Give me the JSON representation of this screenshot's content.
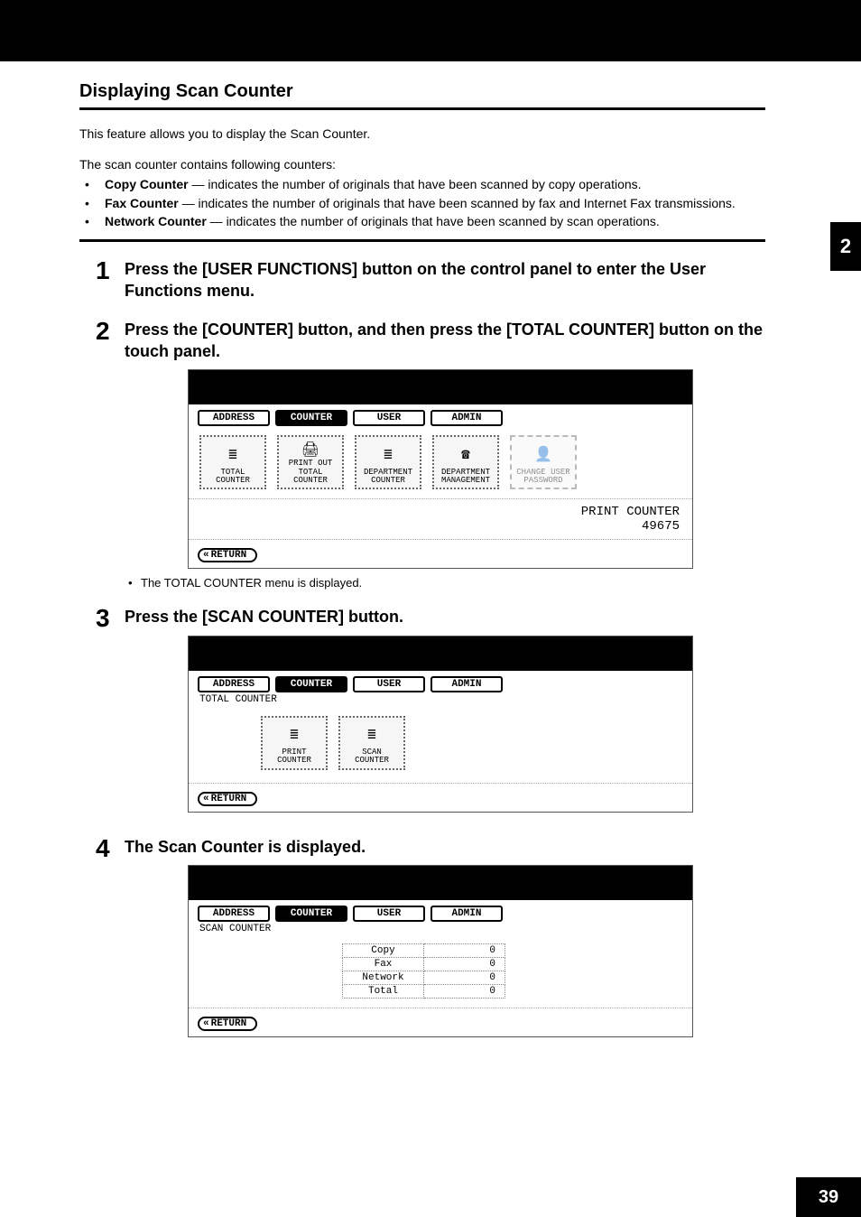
{
  "page_number": "39",
  "chapter_number": "2",
  "section_title": "Displaying Scan Counter",
  "intro_text": "This feature allows you to display the Scan Counter.",
  "counters_intro": "The scan counter contains following counters:",
  "counters": [
    {
      "name": "Copy Counter",
      "desc": " — indicates the number of originals that have been scanned by copy operations."
    },
    {
      "name": "Fax Counter",
      "desc": " — indicates the number of originals that have been scanned by fax and Internet Fax transmissions."
    },
    {
      "name": "Network Counter",
      "desc": " — indicates the number of originals that have been scanned by scan operations."
    }
  ],
  "steps": {
    "s1": {
      "num": "1",
      "text": "Press the [USER FUNCTIONS] button on the control panel to enter the User Functions menu."
    },
    "s2": {
      "num": "2",
      "text": "Press the [COUNTER] button, and then press the [TOTAL COUNTER] button on the touch panel.",
      "note": "The TOTAL COUNTER menu is displayed."
    },
    "s3": {
      "num": "3",
      "text": "Press the [SCAN COUNTER] button."
    },
    "s4": {
      "num": "4",
      "text": "The Scan Counter is displayed."
    }
  },
  "panel_tabs": {
    "address": "ADDRESS",
    "counter": "COUNTER",
    "user": "USER",
    "admin": "ADMIN"
  },
  "panel1": {
    "icons": {
      "total_counter": "TOTAL\nCOUNTER",
      "print_out": "PRINT OUT\nTOTAL COUNTER",
      "dept_counter": "DEPARTMENT\nCOUNTER",
      "dept_mgmt": "DEPARTMENT\nMANAGEMENT",
      "change_pw": "CHANGE USER\nPASSWORD"
    },
    "readout_label": "PRINT COUNTER",
    "readout_value": "49675",
    "return": "RETURN"
  },
  "panel2": {
    "sublabel": "TOTAL COUNTER",
    "icons": {
      "print_counter": "PRINT\nCOUNTER",
      "scan_counter": "SCAN\nCOUNTER"
    },
    "return": "RETURN"
  },
  "panel3": {
    "sublabel": "SCAN COUNTER",
    "rows": [
      {
        "label": "Copy",
        "value": "0"
      },
      {
        "label": "Fax",
        "value": "0"
      },
      {
        "label": "Network",
        "value": "0"
      },
      {
        "label": "Total",
        "value": "0"
      }
    ],
    "return": "RETURN"
  }
}
